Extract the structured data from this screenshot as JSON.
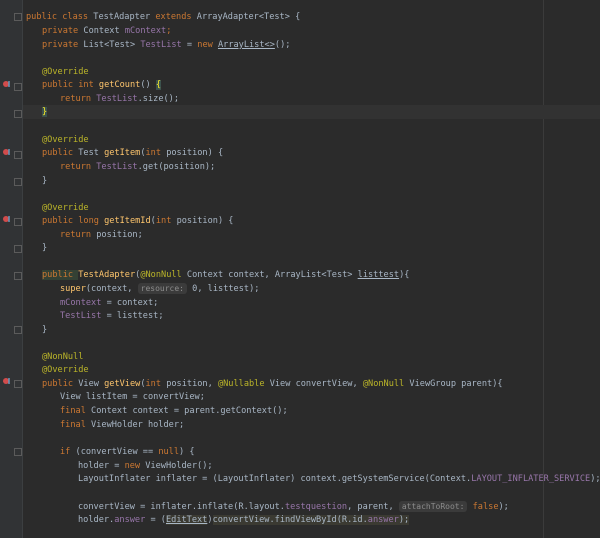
{
  "editor": {
    "lines": {
      "l1": {
        "a": "public class ",
        "b": "TestAdapter ",
        "c": "extends ",
        "d": "ArrayAdapter<Test> {"
      },
      "l2": {
        "a": "private ",
        "b": "Context ",
        "c": "mContext",
        ";": ";"
      },
      "l3": {
        "a": "private ",
        "b": "List<Test> ",
        "c": "TestList",
        " ": " = ",
        "d": "new ",
        "e": "ArrayList<>",
        "f": "();"
      },
      "l4": {
        "a": "@Override"
      },
      "l5": {
        "a": "public int ",
        "b": "getCount",
        "c": "() ",
        "d": "{"
      },
      "l6": {
        "a": "return ",
        "b": "TestList",
        ".": ".size();"
      },
      "l7": {
        "a": "}"
      },
      "l8": {
        "a": "@Override"
      },
      "l9": {
        "a": "public ",
        "b": "Test ",
        "c": "getItem",
        "d": "(",
        "e": "int ",
        "f": "position) {"
      },
      "l10": {
        "a": "return ",
        "b": "TestList",
        ".": ".get(position);"
      },
      "l11": {
        "a": "}"
      },
      "l12": {
        "a": "@Override"
      },
      "l13": {
        "a": "public long ",
        "b": "getItemId",
        "c": "(",
        "d": "int ",
        "e": "position) {"
      },
      "l14": {
        "a": "return ",
        "b": "position;"
      },
      "l15": {
        "a": "}"
      },
      "l16": {
        "a": "public ",
        "b": "TestAdapter",
        "c": "(",
        "d": "@NonNull ",
        "e": "Context context, ArrayList<Test> ",
        "f": "listtest",
        "g": "){"
      },
      "l17": {
        "a": "super",
        "b": "(context, ",
        "hint": "resource:",
        "c": " 0, listtest);"
      },
      "l18": {
        "a": "mContext",
        " ": " = context;"
      },
      "l19": {
        "a": "TestList",
        " ": " = listtest;"
      },
      "l20": {
        "a": "}"
      },
      "l21": {
        "a": "@NonNull"
      },
      "l22": {
        "a": "@Override"
      },
      "l23": {
        "a": "public ",
        "b": "View ",
        "c": "getView",
        "d": "(",
        "e": "int ",
        "f": "position, ",
        "g": "@Nullable ",
        "h": "View convertView, ",
        "i": "@NonNull ",
        "j": "ViewGroup parent){"
      },
      "l24": {
        "a": "View listItem = convertView;"
      },
      "l25": {
        "a": "final ",
        "b": "Context context = parent.getContext();"
      },
      "l26": {
        "a": "final ",
        "b": "ViewHolder holder;"
      },
      "l27": {
        "a": "if ",
        "b": "(convertView == ",
        "c": "null",
        ")": ") {"
      },
      "l28": {
        "a": "holder = ",
        "b": "new ",
        "c": "ViewHolder();"
      },
      "l29": {
        "a": "LayoutInflater inflater = (LayoutInflater) context.getSystemService(Context.",
        "b": "LAYOUT_INFLATER_SERVICE",
        "c": ");"
      },
      "l30": {
        "a": "convertView = inflater.inflate(R.layout.",
        "b": "testquestion",
        ",": ", parent, ",
        "hint": "attachToRoot:",
        "c": " ",
        "d": "false",
        ")": ");"
      },
      "l31": {
        "a": "holder.",
        "b": "answer",
        " ": " = (",
        "c": "EditText",
        ")": ")",
        "d": "convertView.findViewById(R.id.",
        "e": "answer",
        "f": ");"
      }
    }
  },
  "colors": {
    "background": "#2b2b2b",
    "keyword": "#cc7832",
    "field": "#9876aa",
    "annotation": "#bbb529",
    "method": "#ffc66d",
    "text": "#a9b7c6"
  }
}
